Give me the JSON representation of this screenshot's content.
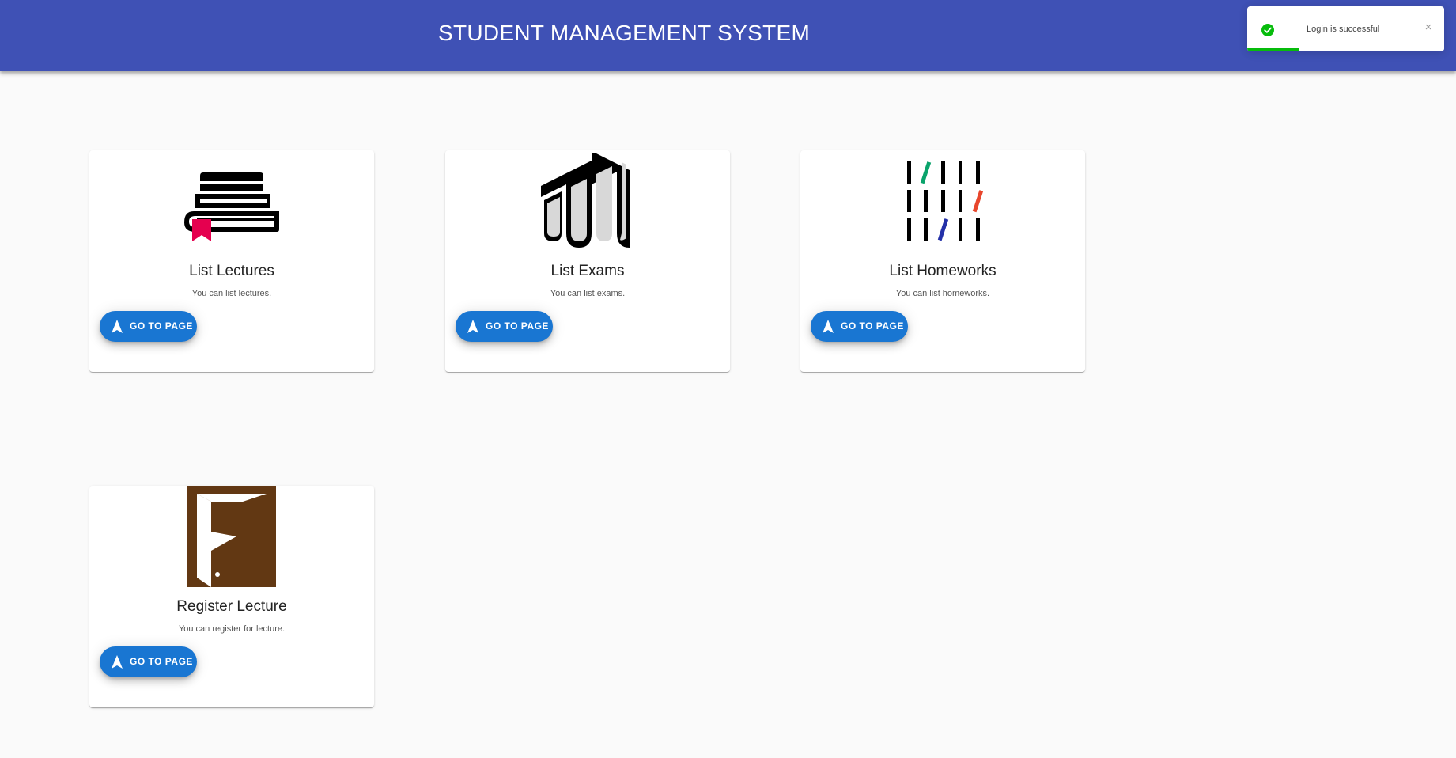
{
  "header": {
    "title": "STUDENT MANAGEMENT SYSTEM",
    "background_color": "#3f51b5"
  },
  "toast": {
    "message": "Login is successful",
    "status_icon": "check-circle-icon",
    "close_icon": "close-icon",
    "close_glyph": "×",
    "progress_fraction": 0.26,
    "success_color": "#07bc0c"
  },
  "cards": [
    {
      "title": "List Lectures",
      "description": "You can list lectures.",
      "button_label": "GO TO PAGE",
      "image_icon": "books-stack-icon",
      "button_icon": "navigation-arrow-icon"
    },
    {
      "title": "List Exams",
      "description": "You can list exams.",
      "button_label": "GO TO PAGE",
      "image_icon": "exam-papers-icon",
      "button_icon": "navigation-arrow-icon"
    },
    {
      "title": "List Homeworks",
      "description": "You can list homeworks.",
      "button_label": "GO TO PAGE",
      "image_icon": "tally-marks-icon",
      "button_icon": "navigation-arrow-icon"
    },
    {
      "title": "Register Lecture",
      "description": "You can register for lecture.",
      "button_label": "GO TO PAGE",
      "image_icon": "open-door-icon",
      "button_icon": "navigation-arrow-icon"
    }
  ],
  "colors": {
    "button": "#1976d2",
    "page_background": "#fafafa",
    "bookmark": "#e5004f",
    "door": "#623813"
  }
}
